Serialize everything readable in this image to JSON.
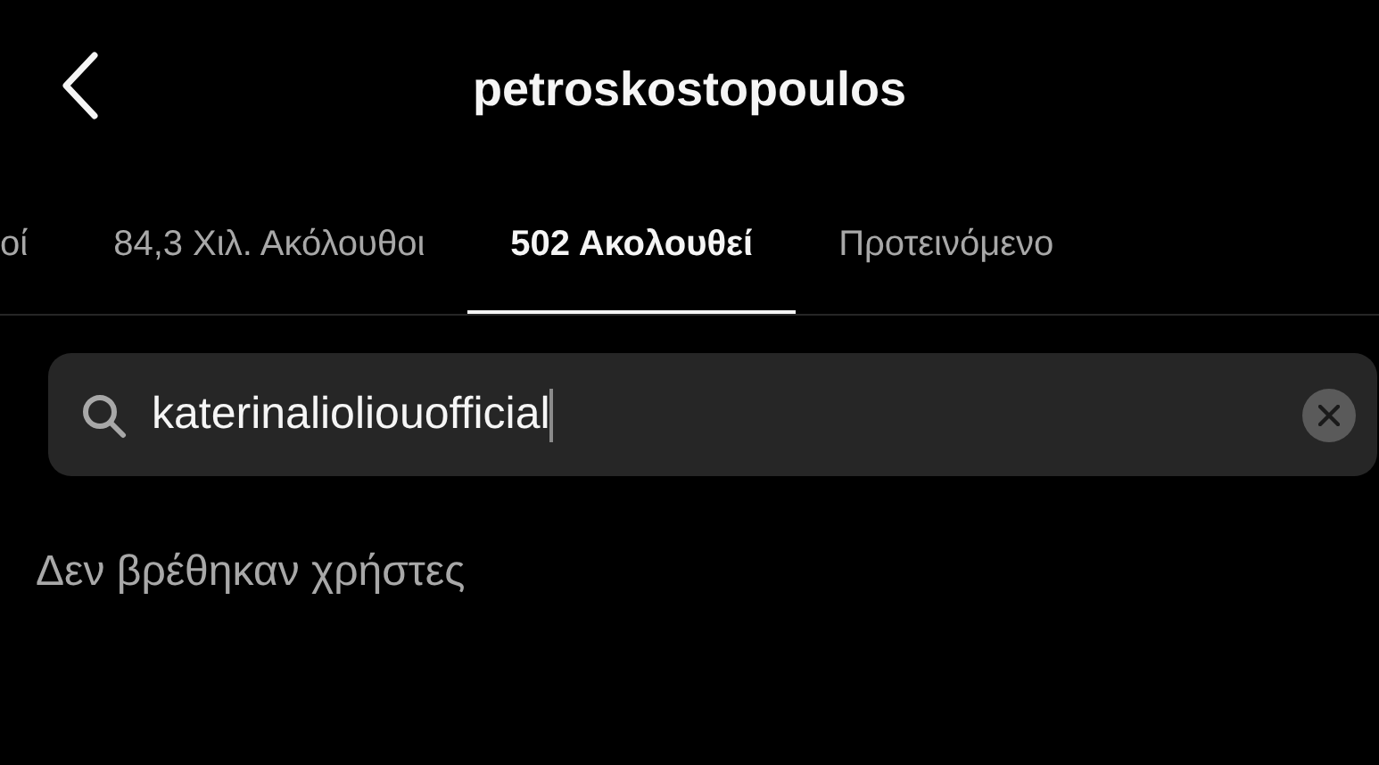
{
  "header": {
    "title": "petroskostopoulos"
  },
  "tabs": [
    {
      "label": "οί",
      "selected": false
    },
    {
      "label": "84,3 Χιλ. Ακόλουθοι",
      "selected": false
    },
    {
      "label": "502 Ακολουθεί",
      "selected": true
    },
    {
      "label": "Προτεινόμενο",
      "selected": false
    }
  ],
  "search": {
    "value": "katerinalioliouofficial",
    "focused": true
  },
  "message": "Δεν βρέθηκαν χρήστες"
}
